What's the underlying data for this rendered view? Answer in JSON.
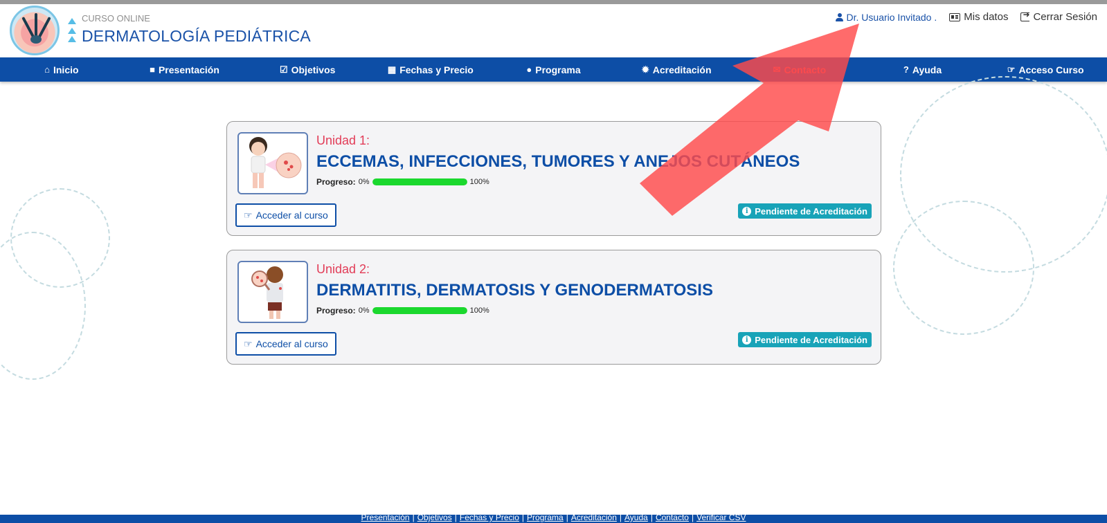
{
  "brand": {
    "subtitle": "CURSO ONLINE",
    "title": "DERMATOLOGÍA  PEDIÁTRICA"
  },
  "user_links": {
    "user": "Dr. Usuario Invitado .",
    "my_data": "Mis datos",
    "logout": "Cerrar Sesión"
  },
  "nav": {
    "items": [
      {
        "label": "Inicio",
        "icon": "home-icon",
        "glyph": "⌂"
      },
      {
        "label": "Presentación",
        "icon": "video-icon",
        "glyph": "■"
      },
      {
        "label": "Objetivos",
        "icon": "checkbox-icon",
        "glyph": "☑"
      },
      {
        "label": "Fechas y Precio",
        "icon": "calendar-icon",
        "glyph": "▦"
      },
      {
        "label": "Programa",
        "icon": "user-doctor-icon",
        "glyph": "●"
      },
      {
        "label": "Acreditación",
        "icon": "certificate-icon",
        "glyph": "✹"
      },
      {
        "label": "Contacto",
        "icon": "envelope-icon",
        "glyph": "✉"
      },
      {
        "label": "Ayuda",
        "icon": "question-icon",
        "glyph": "?"
      },
      {
        "label": "Acceso Curso",
        "icon": "hand-pointer-icon",
        "glyph": "☞"
      }
    ],
    "active_index": 6
  },
  "units": [
    {
      "label": "Unidad 1:",
      "title": "ECCEMAS, INFECCIONES, TUMORES Y ANEJOS CUTÁNEOS",
      "progress_label": "Progreso:",
      "progress_start": "0%",
      "progress_end": "100%",
      "progress_value": 1.0,
      "access_label": "Acceder al curso",
      "status": "Pendiente de Acreditación"
    },
    {
      "label": "Unidad 2:",
      "title": "DERMATITIS, DERMATOSIS Y GENODERMATOSIS",
      "progress_label": "Progreso:",
      "progress_start": "0%",
      "progress_end": "100%",
      "progress_value": 1.0,
      "access_label": "Acceder al curso",
      "status": "Pendiente de Acreditación"
    }
  ],
  "footer": {
    "links": [
      "Presentación",
      "Objetivos",
      "Fechas y Precio",
      "Programa",
      "Acreditación",
      "Ayuda",
      "Contacto",
      "Verificar CSV"
    ],
    "separator": "|"
  },
  "colors": {
    "primary": "#0d4ea6",
    "accent": "#e23c57",
    "badge": "#18a3b8",
    "progress": "#1bd82e",
    "arrow": "#ff4a4a"
  }
}
